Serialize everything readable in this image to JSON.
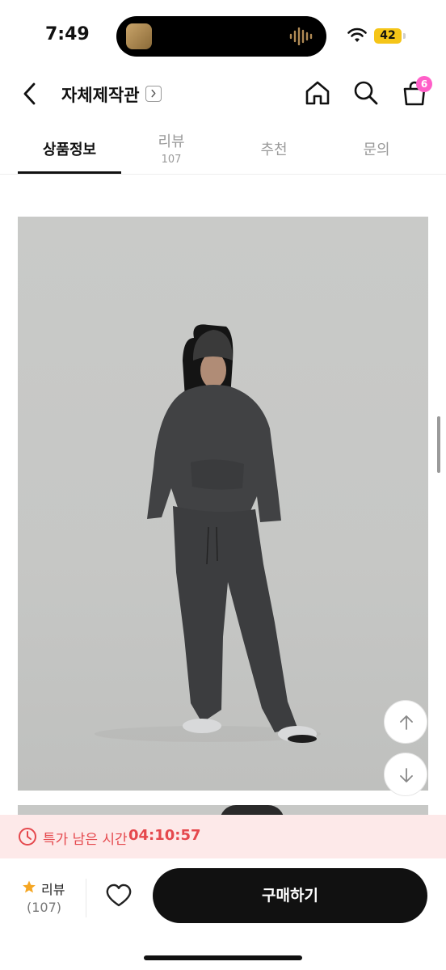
{
  "status_bar": {
    "time": "7:49",
    "battery": "42",
    "icons": [
      "media-thumbnail",
      "audio-wave-icon",
      "wifi-icon",
      "battery-icon"
    ]
  },
  "header": {
    "store_name": "자체제작관",
    "cart_count": "6",
    "icons": [
      "back-icon",
      "chevron-right-icon",
      "home-icon",
      "search-icon",
      "cart-icon"
    ]
  },
  "tabs": [
    {
      "label": "상품정보",
      "active": true
    },
    {
      "label": "리뷰",
      "count": "107"
    },
    {
      "label": "추천"
    },
    {
      "label": "문의"
    }
  ],
  "product_image": {
    "icons": [
      "arrow-up-icon",
      "arrow-down-icon"
    ]
  },
  "timer": {
    "label": "특가 남은 시간",
    "value": "04:10:57",
    "color": "#e5484d",
    "background": "#fde9e9"
  },
  "bottom_bar": {
    "review_label": "리뷰",
    "review_count": "(107)",
    "buy_label": "구매하기",
    "icons": [
      "star-icon",
      "heart-icon"
    ]
  },
  "colors": {
    "accent": "#111111",
    "badge": "#ff5fc8",
    "star": "#f5a623"
  }
}
